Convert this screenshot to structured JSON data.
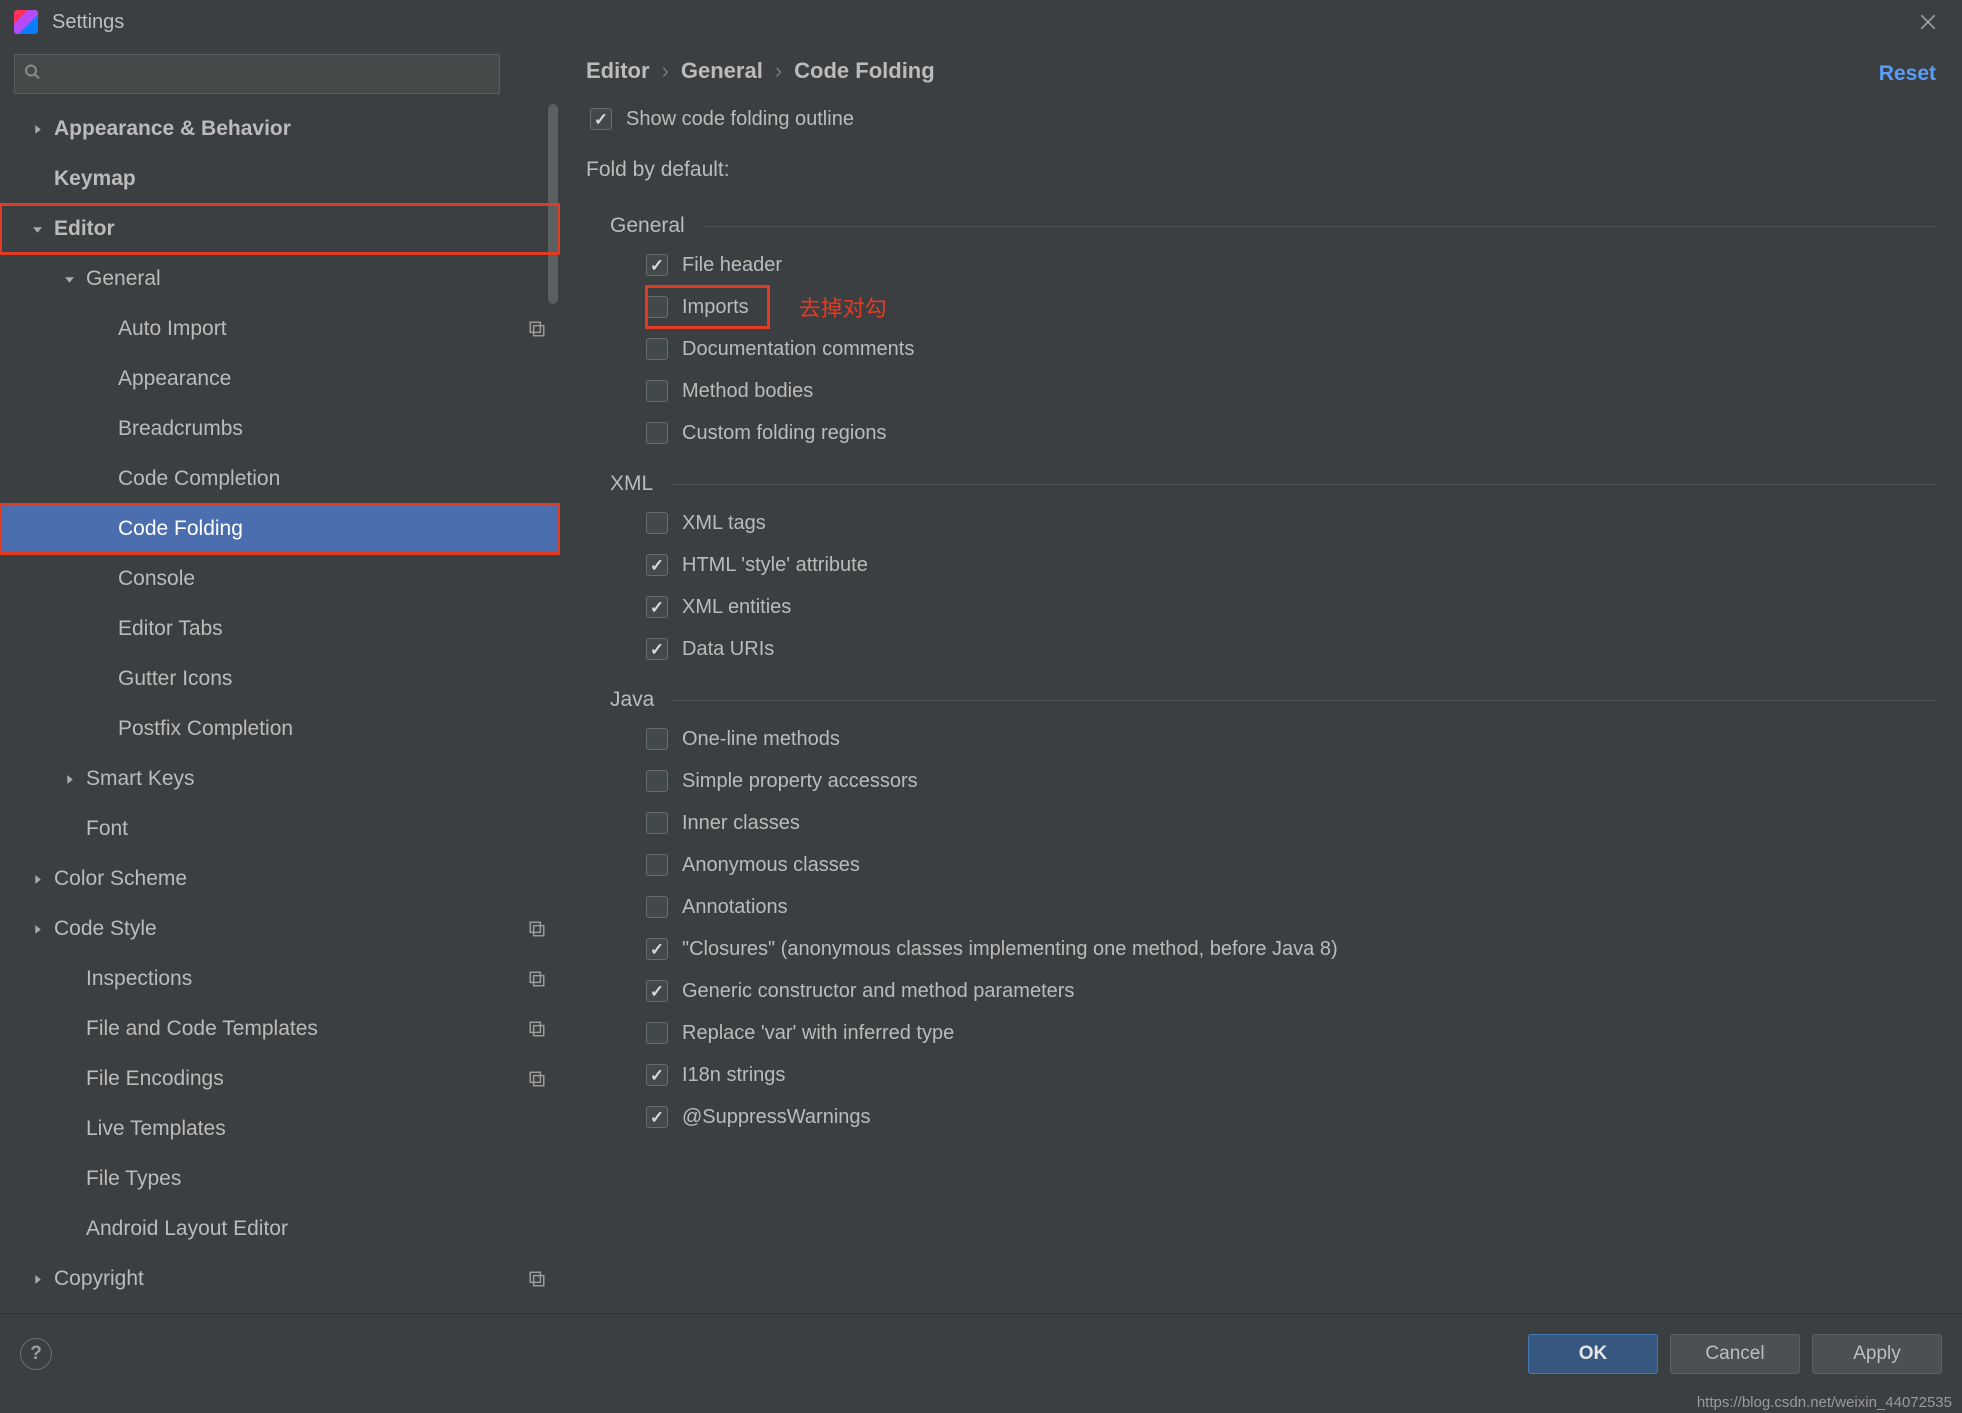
{
  "title": "Settings",
  "search_placeholder": "",
  "reset_label": "Reset",
  "breadcrumbs": [
    "Editor",
    "General",
    "Code Folding"
  ],
  "sidebar": {
    "items": [
      {
        "label": "Appearance & Behavior",
        "depth": 0,
        "arrow": "right",
        "bold": true
      },
      {
        "label": "Keymap",
        "depth": 0,
        "bold": true
      },
      {
        "label": "Editor",
        "depth": 0,
        "arrow": "down",
        "bold": true,
        "highlight": true
      },
      {
        "label": "General",
        "depth": 1,
        "arrow": "down"
      },
      {
        "label": "Auto Import",
        "depth": 2,
        "badge": true
      },
      {
        "label": "Appearance",
        "depth": 2
      },
      {
        "label": "Breadcrumbs",
        "depth": 2
      },
      {
        "label": "Code Completion",
        "depth": 2
      },
      {
        "label": "Code Folding",
        "depth": 2,
        "selected": true,
        "highlight": true
      },
      {
        "label": "Console",
        "depth": 2
      },
      {
        "label": "Editor Tabs",
        "depth": 2
      },
      {
        "label": "Gutter Icons",
        "depth": 2
      },
      {
        "label": "Postfix Completion",
        "depth": 2
      },
      {
        "label": "Smart Keys",
        "depth": 1,
        "arrow": "right"
      },
      {
        "label": "Font",
        "depth": 1
      },
      {
        "label": "Color Scheme",
        "depth": 0,
        "arrow": "right"
      },
      {
        "label": "Code Style",
        "depth": 0,
        "arrow": "right",
        "badge": true
      },
      {
        "label": "Inspections",
        "depth": 1,
        "badge": true
      },
      {
        "label": "File and Code Templates",
        "depth": 1,
        "badge": true
      },
      {
        "label": "File Encodings",
        "depth": 1,
        "badge": true
      },
      {
        "label": "Live Templates",
        "depth": 1
      },
      {
        "label": "File Types",
        "depth": 1
      },
      {
        "label": "Android Layout Editor",
        "depth": 1
      },
      {
        "label": "Copyright",
        "depth": 0,
        "arrow": "right",
        "badge": true
      }
    ]
  },
  "top_checkbox": {
    "label": "Show code folding outline",
    "checked": true
  },
  "fold_by_default_label": "Fold by default:",
  "annotation": "去掉对勾",
  "groups": [
    {
      "name": "General",
      "options": [
        {
          "label": "File header",
          "checked": true
        },
        {
          "label": "Imports",
          "checked": false,
          "highlight": true,
          "annotate": true
        },
        {
          "label": "Documentation comments",
          "checked": false
        },
        {
          "label": "Method bodies",
          "checked": false
        },
        {
          "label": "Custom folding regions",
          "checked": false
        }
      ]
    },
    {
      "name": "XML",
      "options": [
        {
          "label": "XML tags",
          "checked": false
        },
        {
          "label": "HTML 'style' attribute",
          "checked": true
        },
        {
          "label": "XML entities",
          "checked": true
        },
        {
          "label": "Data URIs",
          "checked": true
        }
      ]
    },
    {
      "name": "Java",
      "options": [
        {
          "label": "One-line methods",
          "checked": false
        },
        {
          "label": "Simple property accessors",
          "checked": false
        },
        {
          "label": "Inner classes",
          "checked": false
        },
        {
          "label": "Anonymous classes",
          "checked": false
        },
        {
          "label": "Annotations",
          "checked": false
        },
        {
          "label": "\"Closures\" (anonymous classes implementing one method, before Java 8)",
          "checked": true
        },
        {
          "label": "Generic constructor and method parameters",
          "checked": true
        },
        {
          "label": "Replace 'var' with inferred type",
          "checked": false
        },
        {
          "label": "I18n strings",
          "checked": true
        },
        {
          "label": "@SuppressWarnings",
          "checked": true
        }
      ]
    }
  ],
  "buttons": {
    "ok": "OK",
    "cancel": "Cancel",
    "apply": "Apply"
  },
  "watermark": "https://blog.csdn.net/weixin_44072535"
}
